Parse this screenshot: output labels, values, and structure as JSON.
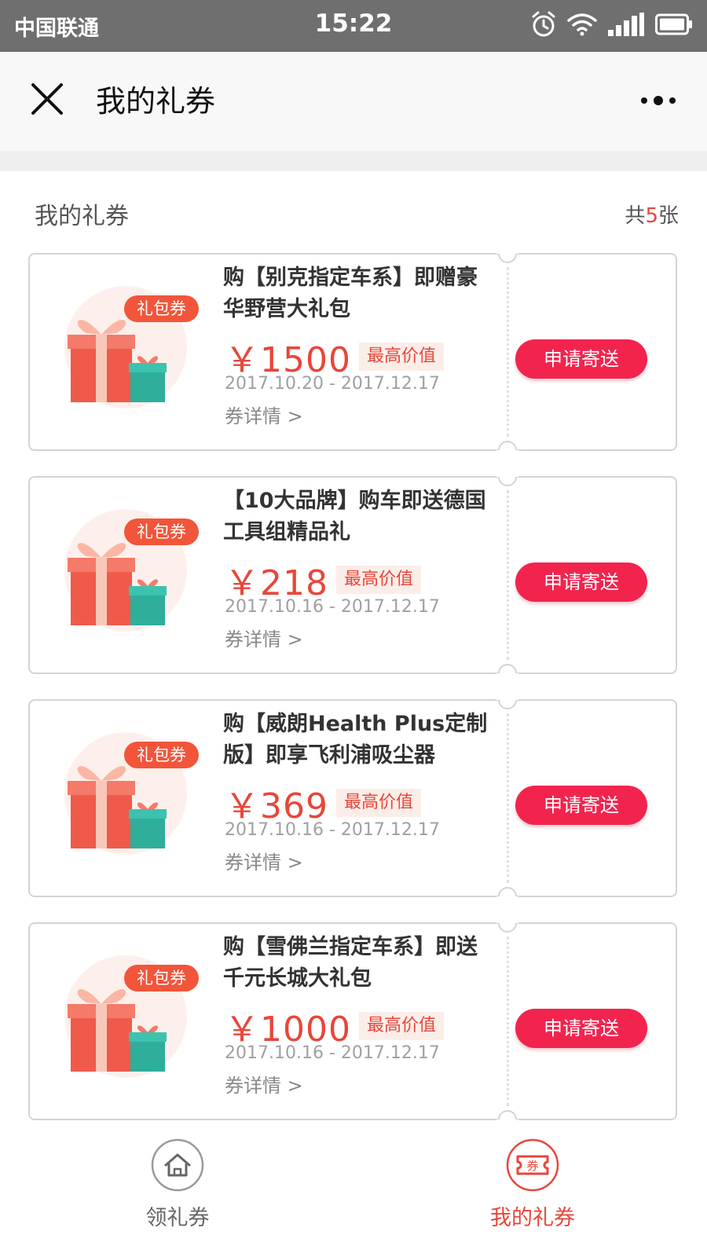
{
  "status_bar": {
    "carrier": "中国联通",
    "time": "15:22"
  },
  "nav": {
    "title": "我的礼券"
  },
  "section": {
    "title": "我的礼券",
    "count_prefix": "共",
    "count": "5",
    "count_suffix": "张"
  },
  "coupons": [
    {
      "badge": "礼包券",
      "title": "购【别克指定车系】即赠豪华野营大礼包",
      "price": "￥1500",
      "price_tag": "最高价值",
      "date": "2017.10.20 - 2017.12.17",
      "detail": "券详情 >",
      "button": "申请寄送"
    },
    {
      "badge": "礼包券",
      "title": "【10大品牌】购车即送德国工具组精品礼",
      "price": "￥218",
      "price_tag": "最高价值",
      "date": "2017.10.16 - 2017.12.17",
      "detail": "券详情 >",
      "button": "申请寄送"
    },
    {
      "badge": "礼包券",
      "title": "购【威朗Health Plus定制版】即享飞利浦吸尘器",
      "price": "￥369",
      "price_tag": "最高价值",
      "date": "2017.10.16 - 2017.12.17",
      "detail": "券详情 >",
      "button": "申请寄送"
    },
    {
      "badge": "礼包券",
      "title": "购【雪佛兰指定车系】即送千元长城大礼包",
      "price": "￥1000",
      "price_tag": "最高价值",
      "date": "2017.10.16 - 2017.12.17",
      "detail": "券详情 >",
      "button": "申请寄送"
    }
  ],
  "tabs": [
    {
      "label": "领礼券",
      "icon": "home-icon",
      "active": false
    },
    {
      "label": "我的礼券",
      "icon": "coupon-icon",
      "icon_text": "券",
      "active": true
    }
  ],
  "colors": {
    "accent": "#e8463a",
    "button": "#f2244e",
    "status_bar": "#6f6f6f",
    "nav_bar": "#f8f8f8"
  }
}
